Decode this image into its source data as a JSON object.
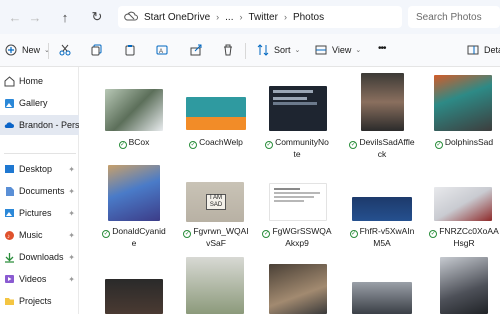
{
  "address_bar": {
    "breadcrumbs": [
      "Start OneDrive",
      "...",
      "Twitter",
      "Photos"
    ],
    "search_placeholder": "Search Photos"
  },
  "toolbar": {
    "new_label": "New",
    "sort_label": "Sort",
    "view_label": "View",
    "more_label": "•••",
    "details_label": "Deta"
  },
  "sidebar": {
    "top_items": [
      {
        "label": "Home",
        "icon": "home-icon"
      },
      {
        "label": "Gallery",
        "icon": "gallery-icon"
      },
      {
        "label": "Brandon - Perso",
        "icon": "cloud-icon"
      }
    ],
    "quick_items": [
      {
        "label": "Desktop",
        "icon": "desktop-icon"
      },
      {
        "label": "Documents",
        "icon": "documents-icon"
      },
      {
        "label": "Pictures",
        "icon": "pictures-icon"
      },
      {
        "label": "Music",
        "icon": "music-icon"
      },
      {
        "label": "Downloads",
        "icon": "downloads-icon"
      },
      {
        "label": "Videos",
        "icon": "videos-icon"
      },
      {
        "label": "Projects",
        "icon": "folder-icon"
      }
    ]
  },
  "files": {
    "row1": [
      {
        "line1": "BCox",
        "line2": ""
      },
      {
        "line1": "CoachWelp",
        "line2": ""
      },
      {
        "line1": "CommunityNo",
        "line2": "te"
      },
      {
        "line1": "DevilsSadAffle",
        "line2": "ck"
      },
      {
        "line1": "DolphinsSad",
        "line2": ""
      }
    ],
    "row2": [
      {
        "line1": "DonaldCyanid",
        "line2": "e"
      },
      {
        "line1": "Fgvrwn_WQAI",
        "line2": "vSaF"
      },
      {
        "line1": "FgWGrSSWQA",
        "line2": "Akxp9"
      },
      {
        "line1": "FhfR-v5XwAIn",
        "line2": "M5A"
      },
      {
        "line1": "FNRZCc0XoAA",
        "line2": "HsgR"
      }
    ]
  },
  "colors": {
    "sync_check": "#2a8d3b",
    "selected_bg": "#e3e8f1",
    "accent": "#0067c0"
  }
}
